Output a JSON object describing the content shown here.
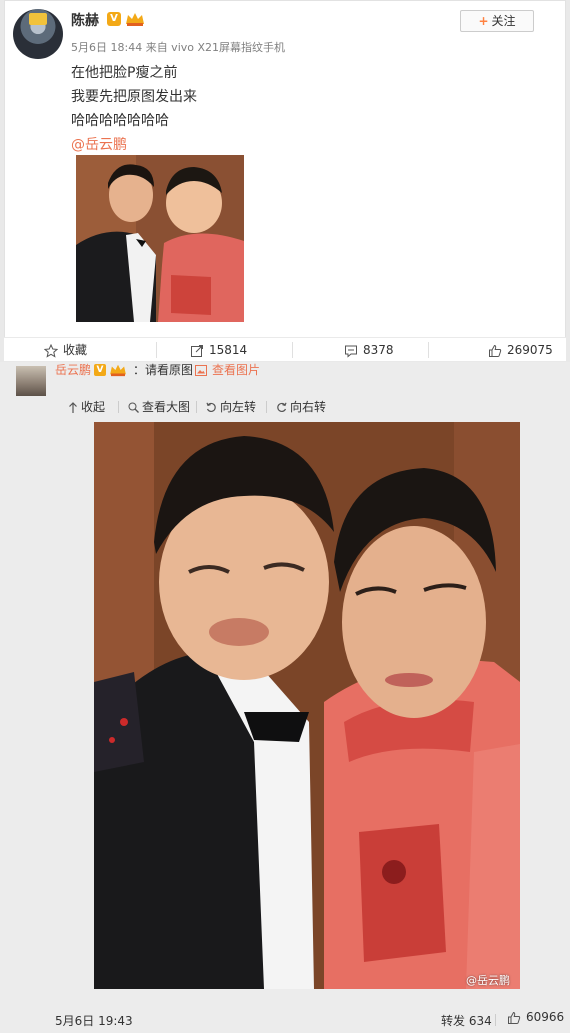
{
  "post": {
    "author": "陈赫",
    "verified_badge": "V",
    "meta": "5月6日 18:44 来自 vivo X21屏幕指纹手机",
    "follow_label": "关注",
    "text_lines": [
      "在他把脸P瘦之前",
      "我要先把原图发出来",
      "哈哈哈哈哈哈哈"
    ],
    "mention": "@岳云鹏"
  },
  "actions": {
    "favorite_label": "收藏",
    "repost_count": "15814",
    "comment_count": "8378",
    "like_count": "269075"
  },
  "comment": {
    "author": "岳云鹏",
    "verified_badge": "V",
    "text": "：请看原图",
    "link_label": "查看图片",
    "toolbar": {
      "collapse": "收起",
      "view_large": "查看大图",
      "rotate_left": "向左转",
      "rotate_right": "向右转"
    },
    "watermark": "@岳云鹏",
    "date": "5月6日 19:43",
    "forward": "转发 634",
    "likes": "60966"
  },
  "colors": {
    "accent": "#eb7350",
    "verified": "#f3a917",
    "follow_plus": "#ff8140"
  }
}
